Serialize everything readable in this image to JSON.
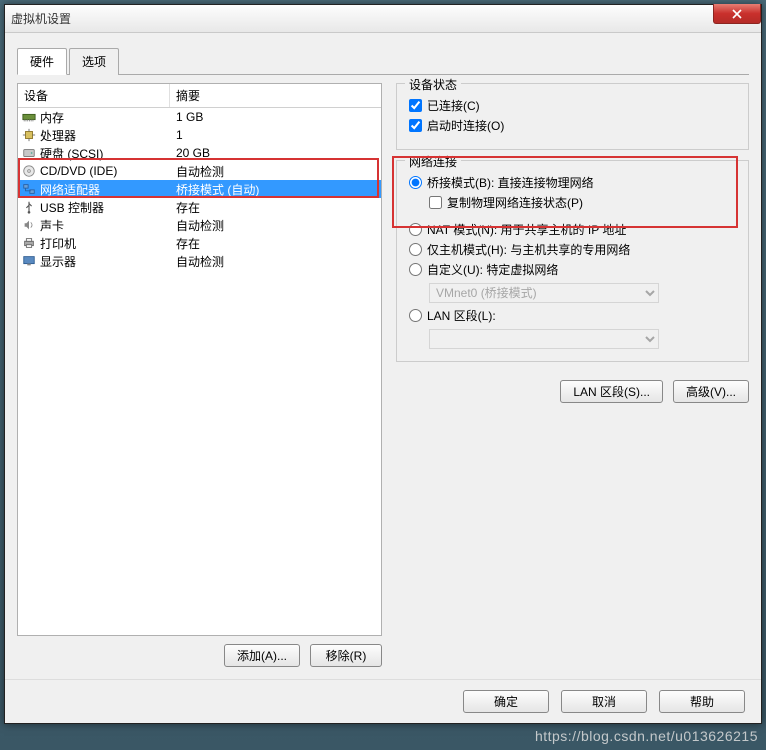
{
  "window": {
    "title": "虚拟机设置"
  },
  "tabs": {
    "hardware": "硬件",
    "options": "选项"
  },
  "columns": {
    "device": "设备",
    "summary": "摘要"
  },
  "devices": [
    {
      "name": "内存",
      "summary": "1 GB",
      "icon": "memory"
    },
    {
      "name": "处理器",
      "summary": "1",
      "icon": "cpu"
    },
    {
      "name": "硬盘 (SCSI)",
      "summary": "20 GB",
      "icon": "disk"
    },
    {
      "name": "CD/DVD (IDE)",
      "summary": "自动检测",
      "icon": "cd"
    },
    {
      "name": "网络适配器",
      "summary": "桥接模式 (自动)",
      "icon": "network",
      "selected": true
    },
    {
      "name": "USB 控制器",
      "summary": "存在",
      "icon": "usb"
    },
    {
      "name": "声卡",
      "summary": "自动检测",
      "icon": "sound"
    },
    {
      "name": "打印机",
      "summary": "存在",
      "icon": "printer"
    },
    {
      "name": "显示器",
      "summary": "自动检测",
      "icon": "display"
    }
  ],
  "left_buttons": {
    "add": "添加(A)...",
    "remove": "移除(R)"
  },
  "status_group": {
    "title": "设备状态",
    "connected": "已连接(C)",
    "connect_at_power_on": "启动时连接(O)"
  },
  "network_group": {
    "title": "网络连接",
    "bridged": "桥接模式(B): 直接连接物理网络",
    "replicate": "复制物理网络连接状态(P)",
    "nat": "NAT 模式(N): 用于共享主机的 IP 地址",
    "hostonly": "仅主机模式(H): 与主机共享的专用网络",
    "custom": "自定义(U): 特定虚拟网络",
    "vmnet_option": "VMnet0 (桥接模式)",
    "lansegment": "LAN 区段(L):",
    "lan_segments_btn": "LAN 区段(S)...",
    "advanced_btn": "高级(V)..."
  },
  "footer": {
    "ok": "确定",
    "cancel": "取消",
    "help": "帮助"
  },
  "watermark": "https://blog.csdn.net/u013626215"
}
